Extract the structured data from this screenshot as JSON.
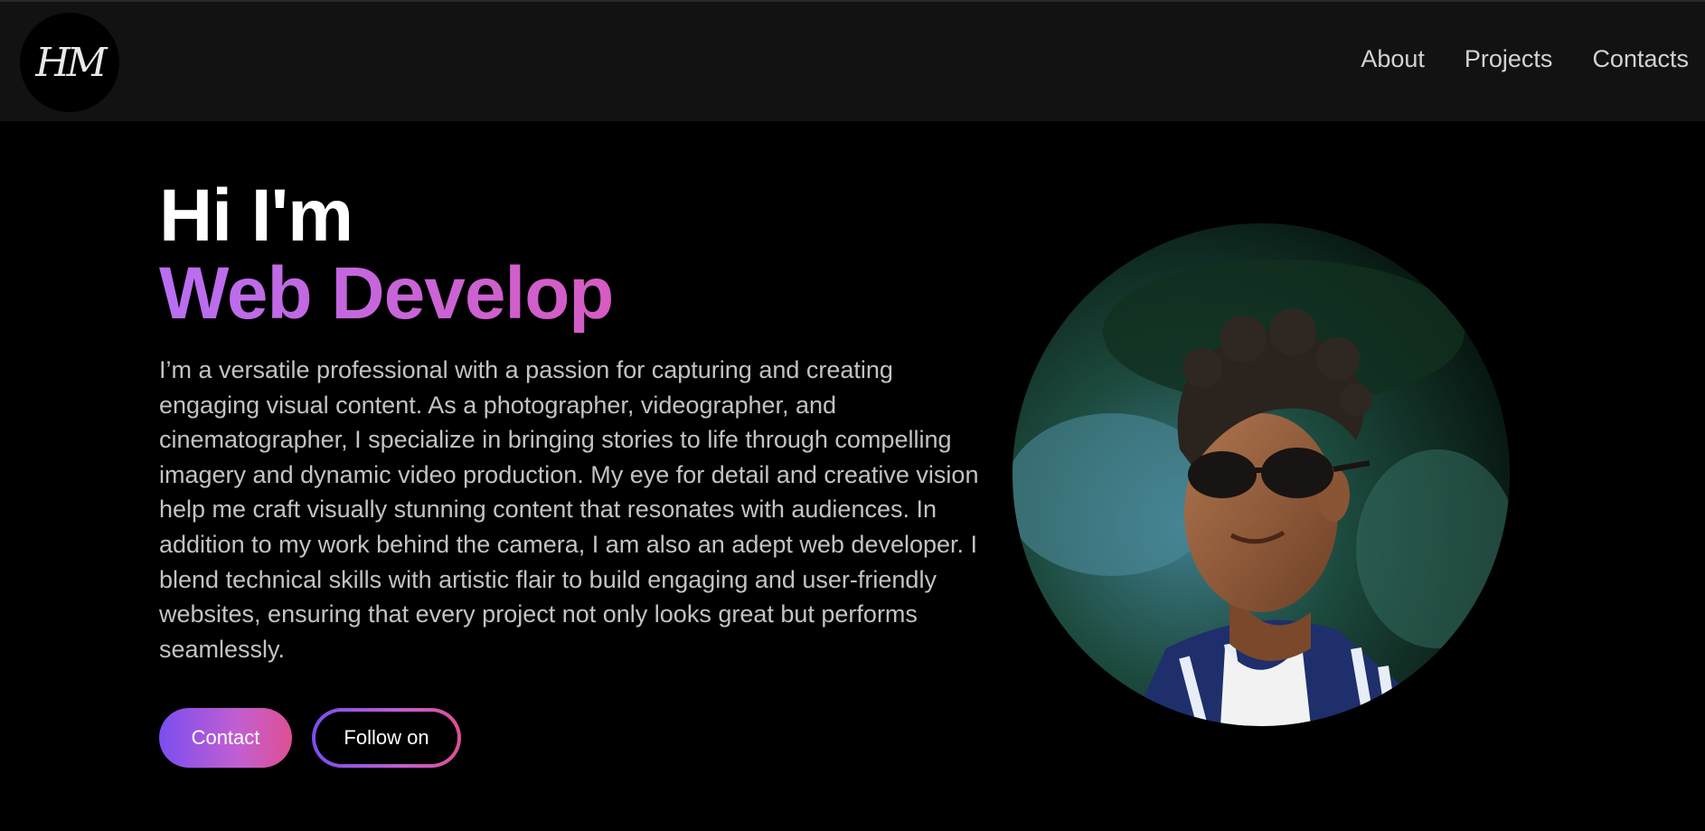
{
  "header": {
    "logo_text": "HM",
    "nav": [
      {
        "label": "About"
      },
      {
        "label": "Projects"
      },
      {
        "label": "Contacts"
      }
    ]
  },
  "hero": {
    "greeting": "Hi I'm",
    "role": "Web Develop",
    "description": "I’m a versatile professional with a passion for capturing and creating engaging visual content. As a photographer, videographer, and cinematographer, I specialize in bringing stories to life through compelling imagery and dynamic video production. My eye for detail and creative vision help me craft visually stunning content that resonates with audiences. In addition to my work behind the camera, I am also an adept web developer. I blend technical skills with artistic flair to build engaging and user-friendly websites, ensuring that every project not only looks great but performs seamlessly.",
    "buttons": {
      "contact": "Contact",
      "follow": "Follow on"
    }
  },
  "colors": {
    "accent_purple": "#b86ff2",
    "accent_pink": "#e8348a",
    "background": "#000000",
    "navbar": "#121212"
  }
}
